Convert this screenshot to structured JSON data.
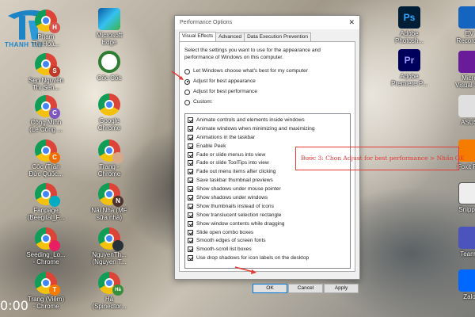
{
  "dialog": {
    "title": "Performance Options",
    "close": "✕",
    "tabs": [
      {
        "label": "Visual Effects",
        "active": true
      },
      {
        "label": "Advanced",
        "active": false
      },
      {
        "label": "Data Execution Prevention",
        "active": false
      }
    ],
    "intro": "Select the settings you want to use for the appearance and performance of Windows on this computer.",
    "radios": [
      {
        "label": "Let Windows choose what's best for my computer",
        "selected": false
      },
      {
        "label": "Adjust for best appearance",
        "selected": true
      },
      {
        "label": "Adjust for best performance",
        "selected": false
      },
      {
        "label": "Custom:",
        "selected": false
      }
    ],
    "effects": [
      "Animate controls and elements inside windows",
      "Animate windows when minimizing and maximizing",
      "Animations in the taskbar",
      "Enable Peek",
      "Fade or slide menus into view",
      "Fade or slide ToolTips into view",
      "Fade out menu items after clicking",
      "Save taskbar thumbnail previews",
      "Show shadows under mouse pointer",
      "Show shadows under windows",
      "Show thumbnails instead of icons",
      "Show translucent selection rectangle",
      "Show window contents while dragging",
      "Slide open combo boxes",
      "Smooth edges of screen fonts",
      "Smooth-scroll list boxes",
      "Use drop shadows for icon labels on the desktop"
    ],
    "buttons": {
      "ok": "OK",
      "cancel": "Cancel",
      "apply": "Apply"
    }
  },
  "annotation": {
    "text": "Bước 3: Chọn Adjust for best performance > Nhấn OK",
    "color": "#e53935"
  },
  "logo": {
    "text": "THANH TIN"
  },
  "clock_partial": "0:00",
  "desktop_icons": {
    "left_col1": [
      {
        "label": "Phạm\nThị Hoà...",
        "badge": "H",
        "badge_color": "#d9534f"
      },
      {
        "label": "Sen Nguyễn\nThị Sen...",
        "badge": "S",
        "badge_color": "#c0392b"
      },
      {
        "label": "Công Minh\n(Lê Công ...",
        "badge": "C",
        "badge_color": "#7e57c2"
      },
      {
        "label": "Côc (Trần\nĐức Quốc...",
        "badge": "C",
        "badge_color": "#ef6c00"
      },
      {
        "label": "Fanpage\n(Beegital_F...",
        "badge": "",
        "badge_color": "#00acc1"
      },
      {
        "label": "Seeding_Lo...\n- Chrome",
        "badge": "",
        "badge_color": "#e91e63"
      },
      {
        "label": "Trang (Việm)\n- Chrome",
        "badge": "T",
        "badge_color": "#f57c00"
      }
    ],
    "left_col2": [
      {
        "label": "Microsoft\nEdge",
        "kind": "edge"
      },
      {
        "label": "Cốc Cốc",
        "kind": "coccoc"
      },
      {
        "label": "Google\nChrome",
        "kind": "chrome"
      },
      {
        "label": "Trang -\nChrome",
        "kind": "chrome-avatar"
      },
      {
        "label": "Nãi Nhà (MF\nsữa nhà)",
        "badge": "N",
        "badge_color": "#4e342e"
      },
      {
        "label": "NguyenTh...\n(Nguyen T...",
        "kind": "chrome-dark"
      },
      {
        "label": "Hà\n(Spinedtor...",
        "badge": "Hà",
        "badge_color": "#388e3c"
      }
    ],
    "right_col1": [
      {
        "label": "Adobe\nPhotosh...",
        "kind": "ps",
        "text": "Ps"
      },
      {
        "label": "Adobe\nPremiere P...",
        "kind": "pr",
        "text": "Pr"
      }
    ],
    "right_col2": [
      {
        "label": "EV\nRecorder",
        "kind": "ev"
      },
      {
        "label": "Micro\nVisual S...",
        "kind": "vs"
      },
      {
        "label": "ASUS",
        "kind": "asus"
      },
      {
        "label": "Foxit P...",
        "kind": "foxit"
      },
      {
        "label": "Snipp...",
        "kind": "snip"
      },
      {
        "label": "Teams",
        "kind": "teams"
      },
      {
        "label": "Zalo",
        "kind": "zalo"
      }
    ]
  }
}
